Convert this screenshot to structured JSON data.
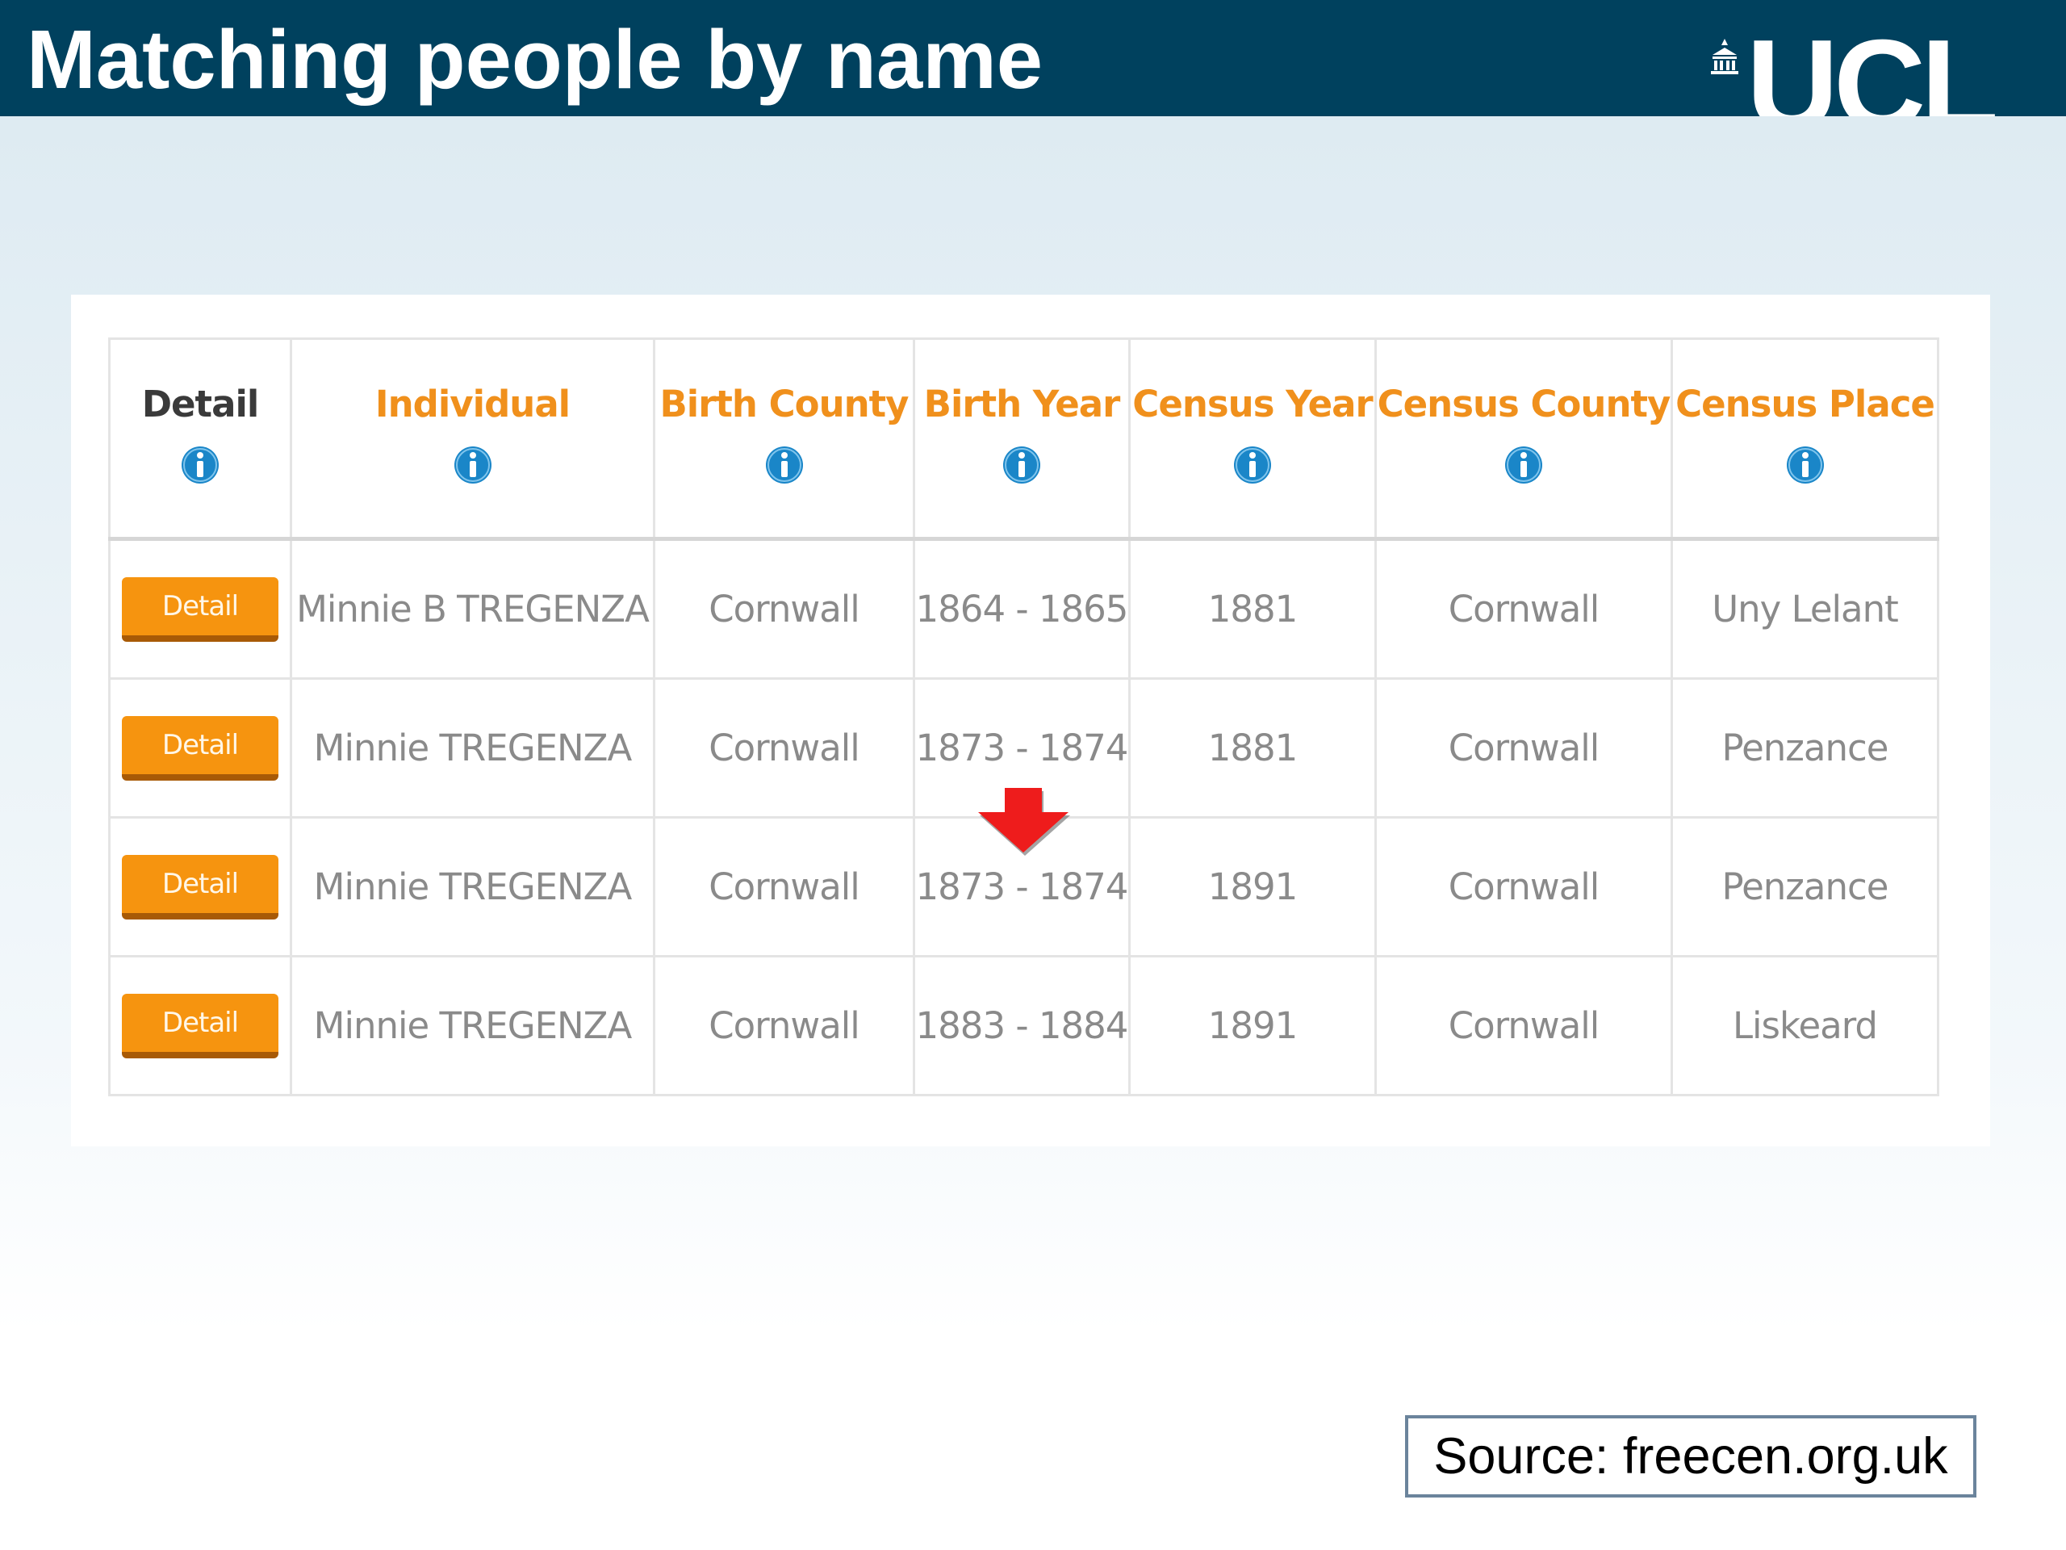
{
  "slide": {
    "title": "Matching people by name",
    "logo_text": "UCL",
    "source": "Source: freecen.org.uk"
  },
  "table": {
    "columns": [
      {
        "key": "detail",
        "label": "Detail"
      },
      {
        "key": "individual",
        "label": "Individual"
      },
      {
        "key": "birth_county",
        "label": "Birth County"
      },
      {
        "key": "birth_year",
        "label": "Birth Year"
      },
      {
        "key": "census_year",
        "label": "Census Year"
      },
      {
        "key": "census_county",
        "label": "Census County"
      },
      {
        "key": "census_place",
        "label": "Census Place"
      }
    ],
    "button_label": "Detail",
    "rows": [
      {
        "individual": "Minnie B TREGENZA",
        "birth_county": "Cornwall",
        "birth_year": "1864 - 1865",
        "census_year": "1881",
        "census_county": "Cornwall",
        "census_place": "Uny Lelant"
      },
      {
        "individual": "Minnie TREGENZA",
        "birth_county": "Cornwall",
        "birth_year": "1873 - 1874",
        "census_year": "1881",
        "census_county": "Cornwall",
        "census_place": "Penzance"
      },
      {
        "individual": "Minnie TREGENZA",
        "birth_county": "Cornwall",
        "birth_year": "1873 - 1874",
        "census_year": "1891",
        "census_county": "Cornwall",
        "census_place": "Penzance"
      },
      {
        "individual": "Minnie TREGENZA",
        "birth_county": "Cornwall",
        "birth_year": "1883 - 1884",
        "census_year": "1891",
        "census_county": "Cornwall",
        "census_place": "Liskeard"
      }
    ]
  },
  "colors": {
    "header_bg": "#00415e",
    "header_accent": "#f0901c",
    "button_bg": "#f6940f",
    "info_icon": "#1a86c8",
    "arrow": "#ee1c1c"
  },
  "icons": {
    "info": "info-icon",
    "arrow": "down-arrow-icon",
    "logo": "ucl-portico-icon"
  }
}
